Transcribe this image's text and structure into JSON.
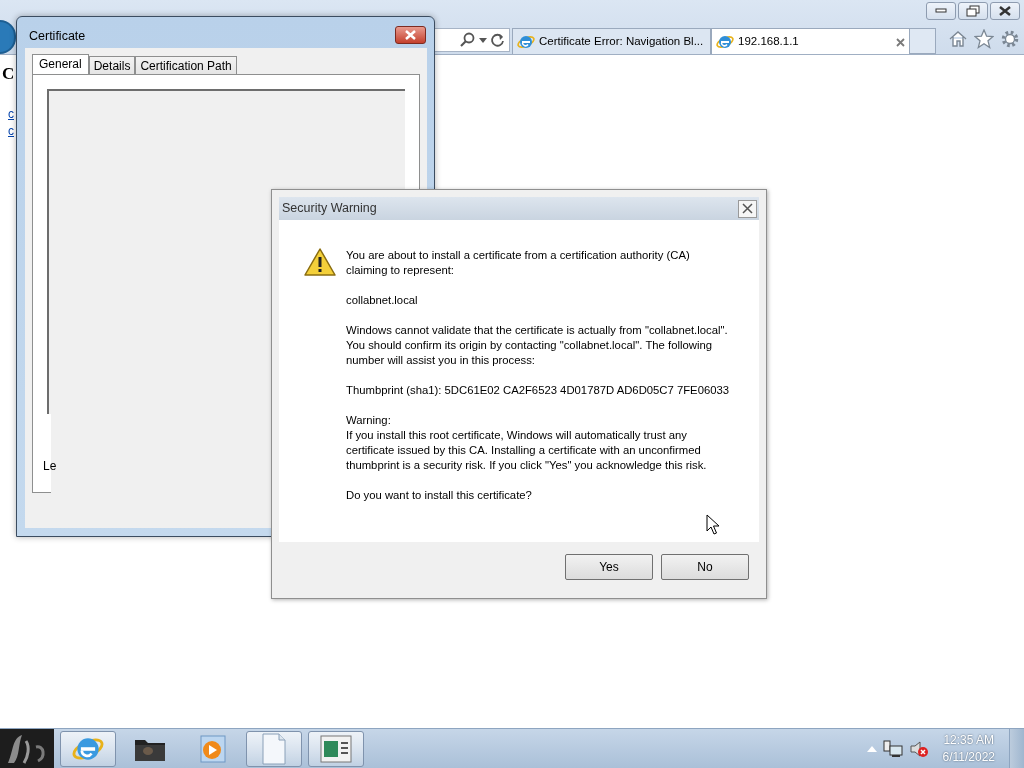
{
  "browser": {
    "tabs": [
      {
        "label": "Certificate Error: Navigation Bl...",
        "selected": false
      },
      {
        "label": "192.168.1.1",
        "selected": true
      }
    ]
  },
  "page": {
    "heading": "C",
    "links": [
      "c",
      "c"
    ]
  },
  "certificate_window": {
    "title": "Certificate",
    "tabs": [
      {
        "label": "General",
        "selected": true
      },
      {
        "label": "Details",
        "selected": false
      },
      {
        "label": "Certification Path",
        "selected": false
      }
    ],
    "partial_label": "Le"
  },
  "security_warning": {
    "title": "Security Warning",
    "paragraphs": [
      "You are about to install a certificate from a certification authority (CA) claiming to represent:",
      "collabnet.local",
      "Windows cannot validate that the certificate is actually from \"collabnet.local\". You should confirm its origin by contacting \"collabnet.local\". The following number will assist you in this process:",
      "Thumbprint (sha1): 5DC61E02 CA2F6523 4D01787D AD6D05C7 7FE06033",
      "Warning:\nIf you install this root certificate, Windows will automatically trust any certificate issued by this CA. Installing a certificate with an unconfirmed thumbprint is a security risk. If you click \"Yes\" you acknowledge this risk.",
      "Do you want to install this certificate?"
    ],
    "buttons": [
      {
        "label": "Yes"
      },
      {
        "label": "No"
      }
    ]
  },
  "taskbar": {
    "apps": [
      {
        "kind": "browser",
        "running": true
      },
      {
        "kind": "folder",
        "running": false
      },
      {
        "kind": "media",
        "running": false
      },
      {
        "kind": "document",
        "running": true
      },
      {
        "kind": "window",
        "running": true
      }
    ],
    "clock": {
      "time": "12:35 AM",
      "date": "6/11/2022"
    }
  }
}
